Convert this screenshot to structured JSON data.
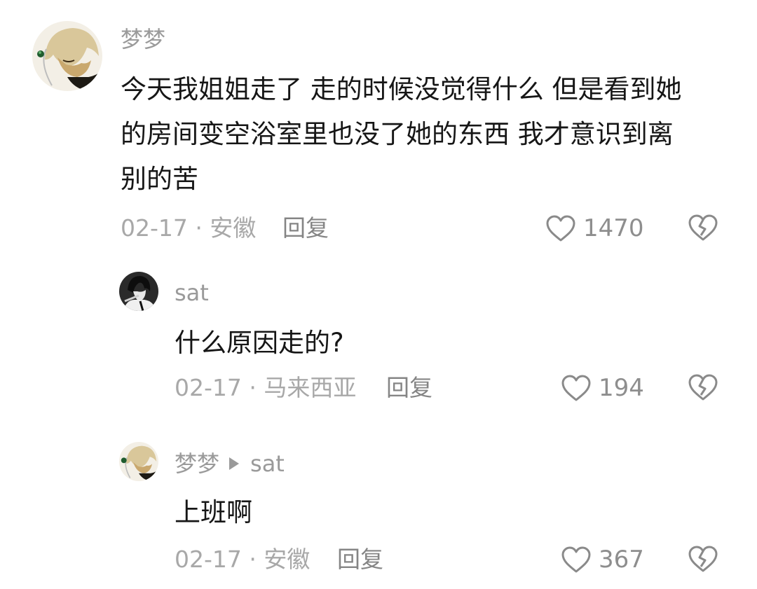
{
  "comment": {
    "username": "梦梦",
    "text_lines": [
      "今天我姐姐走了 走的时候没觉得什么 但是看到她",
      "的房间变空浴室里也没了她的东西 我才意识到离",
      "别的苦"
    ],
    "date": "02-17",
    "location": "安徽",
    "reply_label": "回复",
    "likes": "1470"
  },
  "replies": [
    {
      "username": "sat",
      "reply_to": "",
      "text": "什么原因走的?",
      "date": "02-17",
      "location": "马来西亚",
      "reply_label": "回复",
      "likes": "194"
    },
    {
      "username": "梦梦",
      "reply_to": "sat",
      "text": "上班啊",
      "date": "02-17",
      "location": "安徽",
      "reply_label": "回复",
      "likes": "367"
    }
  ],
  "meta_separator": " · ",
  "colors": {
    "text": "#161616",
    "muted": "#9a9a9a",
    "icon": "#8a8a8a"
  }
}
